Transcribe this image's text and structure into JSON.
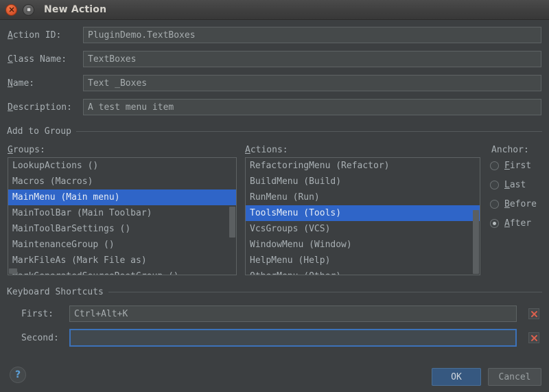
{
  "window": {
    "title": "New Action",
    "close_icon": "close-icon",
    "maximize_icon": "maximize-icon"
  },
  "form": {
    "fields": [
      {
        "label": "Action ID:",
        "mnemonic": "A",
        "rest": "ction ID:",
        "value": "PluginDemo.TextBoxes",
        "name": "action-id"
      },
      {
        "label": "Class Name:",
        "mnemonic": "C",
        "rest": "lass Name:",
        "value": "TextBoxes",
        "name": "class-name"
      },
      {
        "label": "Name:",
        "mnemonic": "N",
        "rest": "ame:",
        "value": "Text _Boxes",
        "name": "name"
      },
      {
        "label": "Description:",
        "mnemonic": "D",
        "rest": "escription:",
        "value": "A test menu item",
        "name": "description"
      }
    ]
  },
  "add_to_group": {
    "section_title": "Add to Group",
    "groups": {
      "label_mnemonic": "G",
      "label_rest": "roups:",
      "items": [
        {
          "text": "LookupActions ()",
          "selected": false
        },
        {
          "text": "Macros (Macros)",
          "selected": false
        },
        {
          "text": "MainMenu (Main menu)",
          "selected": true
        },
        {
          "text": "MainToolBar (Main Toolbar)",
          "selected": false
        },
        {
          "text": "MainToolBarSettings ()",
          "selected": false
        },
        {
          "text": "MaintenanceGroup ()",
          "selected": false
        },
        {
          "text": "MarkFileAs (Mark File as)",
          "selected": false
        },
        {
          "text": "MarkGeneratedSourceRootGroup ()",
          "selected": false
        }
      ]
    },
    "actions": {
      "label_mnemonic": "A",
      "label_rest": "ctions:",
      "items": [
        {
          "text": "RefactoringMenu (Refactor)",
          "selected": false
        },
        {
          "text": "BuildMenu (Build)",
          "selected": false
        },
        {
          "text": "RunMenu (Run)",
          "selected": false
        },
        {
          "text": "ToolsMenu (Tools)",
          "selected": true
        },
        {
          "text": "VcsGroups (VCS)",
          "selected": false
        },
        {
          "text": "WindowMenu (Window)",
          "selected": false
        },
        {
          "text": "HelpMenu (Help)",
          "selected": false
        },
        {
          "text": "OtherMenu (Other)",
          "selected": false
        }
      ]
    },
    "anchor": {
      "label": "Anchor:",
      "options": [
        {
          "mnemonic": "F",
          "rest": "irst",
          "selected": false
        },
        {
          "mnemonic": "L",
          "rest": "ast",
          "selected": false
        },
        {
          "mnemonic": "B",
          "rest": "efore",
          "selected": false
        },
        {
          "mnemonic": "A",
          "rest": "fter",
          "selected": true
        }
      ]
    }
  },
  "keyboard_shortcuts": {
    "section_title": "Keyboard Shortcuts",
    "first": {
      "label": "First:",
      "value": "Ctrl+Alt+K",
      "clear_icon": "clear-x-icon",
      "focused": false
    },
    "second": {
      "label": "Second:",
      "value": "",
      "clear_icon": "clear-x-icon",
      "focused": true
    }
  },
  "footer": {
    "help_glyph": "?",
    "help_icon": "help-icon",
    "ok_label": "OK",
    "cancel_label": "Cancel"
  },
  "colors": {
    "dialog_bg": "#3c3f41",
    "selection_blue": "#2f65c8",
    "focus_blue": "#3c72b9",
    "ok_button": "#365880",
    "clear_red": "#d9604e",
    "help_blue": "#5c9fd6"
  }
}
